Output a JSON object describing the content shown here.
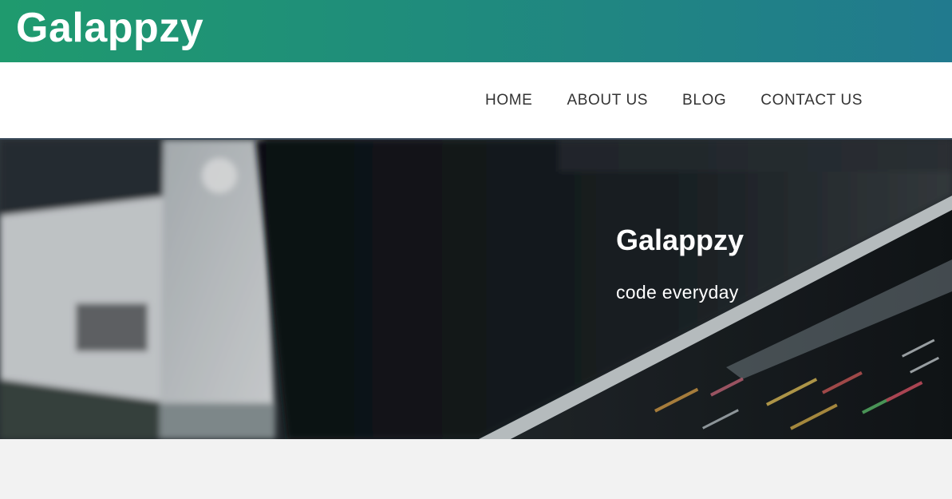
{
  "header": {
    "brand": "Galappzy",
    "gradient_start": "#1f9a6e",
    "gradient_end": "#217a8e"
  },
  "nav": {
    "items": [
      {
        "label": "HOME"
      },
      {
        "label": "ABOUT US"
      },
      {
        "label": "BLOG"
      },
      {
        "label": "CONTACT US"
      }
    ]
  },
  "hero": {
    "title": "Galappzy",
    "subtitle": "code everyday",
    "image_subject": "laptop screen showing code"
  }
}
